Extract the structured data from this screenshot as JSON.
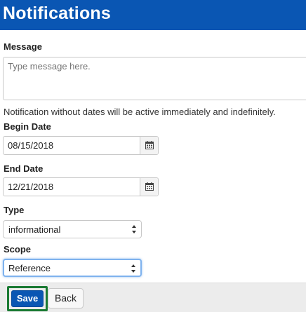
{
  "header": {
    "title": "Notifications"
  },
  "message": {
    "label": "Message",
    "placeholder": "Type message here."
  },
  "note": "Notification without dates will be active immediately and indefinitely.",
  "begin_date": {
    "label": "Begin Date",
    "value": "08/15/2018",
    "icon": "calendar-icon"
  },
  "end_date": {
    "label": "End Date",
    "value": "12/21/2018",
    "icon": "calendar-icon"
  },
  "type": {
    "label": "Type",
    "selected": "informational"
  },
  "scope": {
    "label": "Scope",
    "selected": "Reference"
  },
  "footer": {
    "save_label": "Save",
    "back_label": "Back"
  },
  "colors": {
    "header_bg": "#0a56b3",
    "primary": "#0a56b3",
    "focus_outline": "#1a7a32",
    "focus_ring": "#7eb2ee"
  }
}
